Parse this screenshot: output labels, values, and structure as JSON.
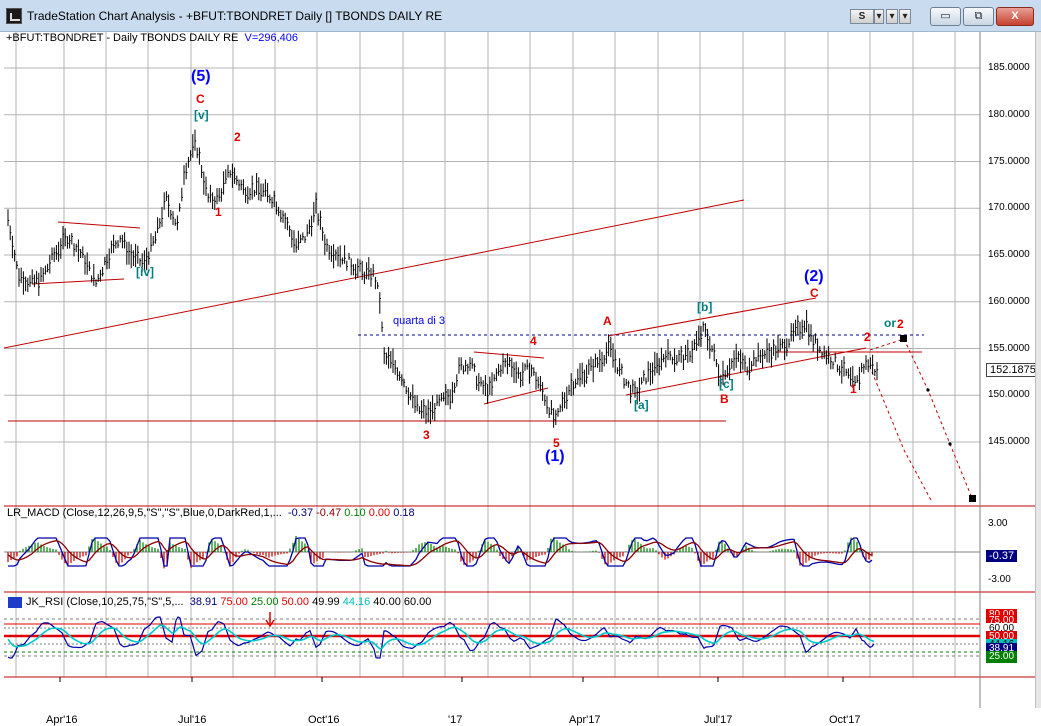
{
  "window": {
    "title": "TradeStation Chart Analysis - +BFUT:TBONDRET Daily [] TBONDS DAILY RE",
    "toolbar_buttons": [
      "S",
      "▾",
      "▾",
      "▾"
    ],
    "controls": {
      "minimize": "▭",
      "restore": "⧉",
      "close": "X"
    }
  },
  "price_panel": {
    "caption_symbol": "+BFUT:TBONDRET - Daily  TBONDS DAILY RE",
    "caption_volume": "V=296,406",
    "y_ticks": [
      "185.0000",
      "180.0000",
      "175.0000",
      "170.0000",
      "165.0000",
      "160.0000",
      "155.0000",
      "150.0000",
      "145.0000"
    ],
    "last_price": "152.1875",
    "annotation": "quarta di 3",
    "wave_labels": [
      {
        "text": "(5)",
        "color": "#0000ff"
      },
      {
        "text": "C",
        "color": "#e00000"
      },
      {
        "text": "[v]",
        "color": "#008080"
      },
      {
        "text": "2",
        "color": "#e00000"
      },
      {
        "text": "1",
        "color": "#e00000"
      },
      {
        "text": "[iv]",
        "color": "#008080"
      },
      {
        "text": "4",
        "color": "#e00000"
      },
      {
        "text": "3",
        "color": "#e00000"
      },
      {
        "text": "5",
        "color": "#e00000"
      },
      {
        "text": "(1)",
        "color": "#0000ff"
      },
      {
        "text": "A",
        "color": "#e00000"
      },
      {
        "text": "[a]",
        "color": "#008080"
      },
      {
        "text": "[b]",
        "color": "#008080"
      },
      {
        "text": "[c]",
        "color": "#008080"
      },
      {
        "text": "B",
        "color": "#e00000"
      },
      {
        "text": "(2)",
        "color": "#0000ff"
      },
      {
        "text": "C",
        "color": "#e00000"
      },
      {
        "text": "2",
        "color": "#e00000"
      },
      {
        "text": "1",
        "color": "#e00000"
      },
      {
        "text": "or",
        "color": "#008080"
      },
      {
        "text": "2",
        "color": "#e00000"
      }
    ]
  },
  "macd_panel": {
    "caption_name": "LR_MACD (Close,12,26,9,5,\"S\",\"S\",Blue,0,DarkRed,1,...",
    "values": [
      {
        "text": "-0.37",
        "color": "#000080"
      },
      {
        "text": "-0.47",
        "color": "#8b0000"
      },
      {
        "text": "0.10",
        "color": "#008000"
      },
      {
        "text": "0.00",
        "color": "#e00000"
      },
      {
        "text": "0.18",
        "color": "#000080"
      }
    ],
    "y_ticks": [
      "3.00",
      "-3.00"
    ],
    "current_value": "-0.37"
  },
  "rsi_panel": {
    "caption_name": "JK_RSI (Close,10,25,75,\"S\",5,...",
    "values": [
      {
        "text": "38.91",
        "color": "#000080"
      },
      {
        "text": "75.00",
        "color": "#e00000"
      },
      {
        "text": "25.00",
        "color": "#008000"
      },
      {
        "text": "50.00",
        "color": "#e00000"
      },
      {
        "text": "49.99",
        "color": "#000000"
      },
      {
        "text": "44.16",
        "color": "#00c0c0"
      },
      {
        "text": "40.00",
        "color": "#000000"
      },
      {
        "text": "60.00",
        "color": "#000000"
      }
    ],
    "badges": [
      {
        "text": "80.00",
        "bg": "#e00000",
        "fg": "#ffffff"
      },
      {
        "text": "75.00",
        "bg": "#e00000",
        "fg": "#ffffff"
      },
      {
        "text": "60.00",
        "bg": "#ffffff",
        "fg": "#000000"
      },
      {
        "text": "50.00",
        "bg": "#e00000",
        "fg": "#ffffff"
      },
      {
        "text": "44.16",
        "bg": "#00c0c0",
        "fg": "#000000"
      },
      {
        "text": "38.91",
        "bg": "#000080",
        "fg": "#ffffff"
      },
      {
        "text": "25.00",
        "bg": "#008000",
        "fg": "#ffffff"
      }
    ]
  },
  "x_axis": {
    "labels": [
      "Apr'16",
      "Jul'16",
      "Oct'16",
      "'17",
      "Apr'17",
      "Jul'17",
      "Oct'17"
    ]
  }
}
